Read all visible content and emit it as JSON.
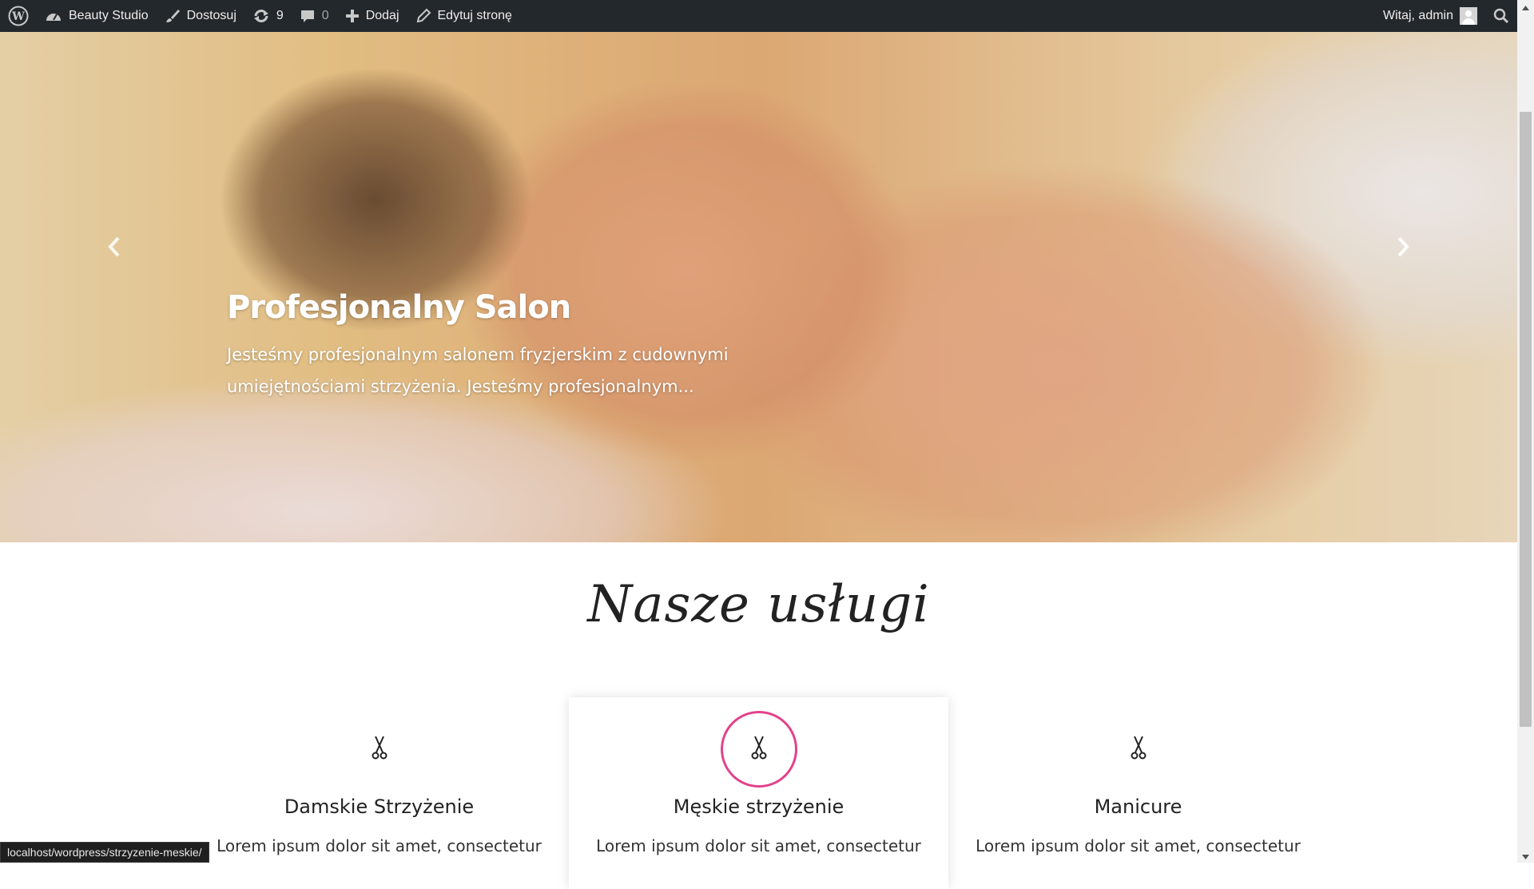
{
  "admin_bar": {
    "wp_logo_icon": "wordpress-icon",
    "site_name": "Beauty Studio",
    "customize": "Dostosuj",
    "updates_count": "9",
    "comments_count": "0",
    "new": "Dodaj",
    "edit_page": "Edytuj stronę",
    "greeting": "Witaj, admin"
  },
  "hero": {
    "title": "Profesjonalny Salon",
    "description": "Jesteśmy profesjonalnym salonem fryzjerskim z cudownymi umiejętnościami strzyżenia. Jesteśmy profesjonalnym..."
  },
  "services": {
    "heading": "Nasze usługi",
    "items": [
      {
        "title": "Damskie Strzyżenie",
        "text": "Lorem ipsum dolor sit amet, consectetur",
        "icon": "scissors-icon"
      },
      {
        "title": "Męskie strzyżenie",
        "text": "Lorem ipsum dolor sit amet, consectetur",
        "icon": "scissors-icon"
      },
      {
        "title": "Manicure",
        "text": "Lorem ipsum dolor sit amet, consectetur",
        "icon": "scissors-icon"
      }
    ]
  },
  "status_bar": {
    "url": "localhost/wordpress/strzyzenie-meskie/"
  },
  "colors": {
    "admin_bar_bg": "#23282d",
    "accent_pink": "#e3418b"
  }
}
